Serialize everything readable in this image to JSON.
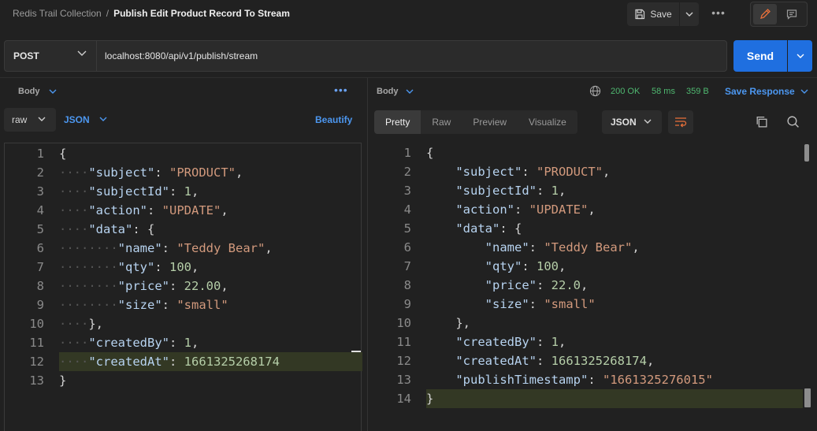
{
  "header": {
    "collection": "Redis Trail Collection",
    "separator": "/",
    "request_name": "Publish Edit Product Record To Stream",
    "save_label": "Save",
    "more_label": "•••"
  },
  "request": {
    "method": "POST",
    "url": "localhost:8080/api/v1/publish/stream",
    "send_label": "Send"
  },
  "left_pane": {
    "body_label": "Body",
    "more_label": "•••",
    "mode": "raw",
    "language": "JSON",
    "beautify_label": "Beautify",
    "lines": [
      {
        "n": "1",
        "html": "<span class='punc'>{</span>"
      },
      {
        "n": "2",
        "html": "<span class='dot'>····</span><span class='key'>\"subject\"</span><span class='punc'>: </span><span class='str'>\"PRODUCT\"</span><span class='punc'>,</span>"
      },
      {
        "n": "3",
        "html": "<span class='dot'>····</span><span class='key'>\"subjectId\"</span><span class='punc'>: </span><span class='num'>1</span><span class='punc'>,</span>"
      },
      {
        "n": "4",
        "html": "<span class='dot'>····</span><span class='key'>\"action\"</span><span class='punc'>: </span><span class='str'>\"UPDATE\"</span><span class='punc'>,</span>"
      },
      {
        "n": "5",
        "html": "<span class='dot'>····</span><span class='key'>\"data\"</span><span class='punc'>: {</span>"
      },
      {
        "n": "6",
        "html": "<span class='dot'>········</span><span class='key'>\"name\"</span><span class='punc'>: </span><span class='str'>\"Teddy Bear\"</span><span class='punc'>,</span>"
      },
      {
        "n": "7",
        "html": "<span class='dot'>········</span><span class='key'>\"qty\"</span><span class='punc'>: </span><span class='num'>100</span><span class='punc'>,</span>"
      },
      {
        "n": "8",
        "html": "<span class='dot'>········</span><span class='key'>\"price\"</span><span class='punc'>: </span><span class='num'>22.00</span><span class='punc'>,</span>"
      },
      {
        "n": "9",
        "html": "<span class='dot'>········</span><span class='key'>\"size\"</span><span class='punc'>: </span><span class='str'>\"small\"</span>"
      },
      {
        "n": "10",
        "html": "<span class='dot'>····</span><span class='punc'>},</span>"
      },
      {
        "n": "11",
        "html": "<span class='dot'>····</span><span class='key'>\"createdBy\"</span><span class='punc'>: </span><span class='num'>1</span><span class='punc'>,</span>"
      },
      {
        "n": "12",
        "html": "<span class='dot'>····</span><span class='key'>\"createdAt\"</span><span class='punc'>: </span><span class='num'>1661325268174</span>",
        "highlight": true
      },
      {
        "n": "13",
        "html": "<span class='punc'>}</span>"
      }
    ]
  },
  "right_pane": {
    "body_label": "Body",
    "status_code": "200 OK",
    "time": "58 ms",
    "size": "359 B",
    "save_response_label": "Save Response",
    "tabs": [
      "Pretty",
      "Raw",
      "Preview",
      "Visualize"
    ],
    "language": "JSON",
    "lines": [
      {
        "n": "1",
        "html": "<span class='punc'>{</span>"
      },
      {
        "n": "2",
        "html": "    <span class='key'>\"subject\"</span><span class='punc'>: </span><span class='str'>\"PRODUCT\"</span><span class='punc'>,</span>"
      },
      {
        "n": "3",
        "html": "    <span class='key'>\"subjectId\"</span><span class='punc'>: </span><span class='num'>1</span><span class='punc'>,</span>"
      },
      {
        "n": "4",
        "html": "    <span class='key'>\"action\"</span><span class='punc'>: </span><span class='str'>\"UPDATE\"</span><span class='punc'>,</span>"
      },
      {
        "n": "5",
        "html": "    <span class='key'>\"data\"</span><span class='punc'>: {</span>"
      },
      {
        "n": "6",
        "html": "        <span class='key'>\"name\"</span><span class='punc'>: </span><span class='str'>\"Teddy Bear\"</span><span class='punc'>,</span>"
      },
      {
        "n": "7",
        "html": "        <span class='key'>\"qty\"</span><span class='punc'>: </span><span class='num'>100</span><span class='punc'>,</span>"
      },
      {
        "n": "8",
        "html": "        <span class='key'>\"price\"</span><span class='punc'>: </span><span class='num'>22.0</span><span class='punc'>,</span>"
      },
      {
        "n": "9",
        "html": "        <span class='key'>\"size\"</span><span class='punc'>: </span><span class='str'>\"small\"</span>"
      },
      {
        "n": "10",
        "html": "    <span class='punc'>},</span>"
      },
      {
        "n": "11",
        "html": "    <span class='key'>\"createdBy\"</span><span class='punc'>: </span><span class='num'>1</span><span class='punc'>,</span>"
      },
      {
        "n": "12",
        "html": "    <span class='key'>\"createdAt\"</span><span class='punc'>: </span><span class='num'>1661325268174</span><span class='punc'>,</span>"
      },
      {
        "n": "13",
        "html": "    <span class='key'>\"publishTimestamp\"</span><span class='punc'>: </span><span class='str'>\"1661325276015\"</span>"
      },
      {
        "n": "14",
        "html": "<span class='punc'>}</span>",
        "highlight": true
      }
    ]
  },
  "colors": {
    "send_button": "#1f6fe0",
    "status_ok": "#4fb870",
    "link_blue": "#4c97f0",
    "edit_icon": "#e8703a"
  }
}
